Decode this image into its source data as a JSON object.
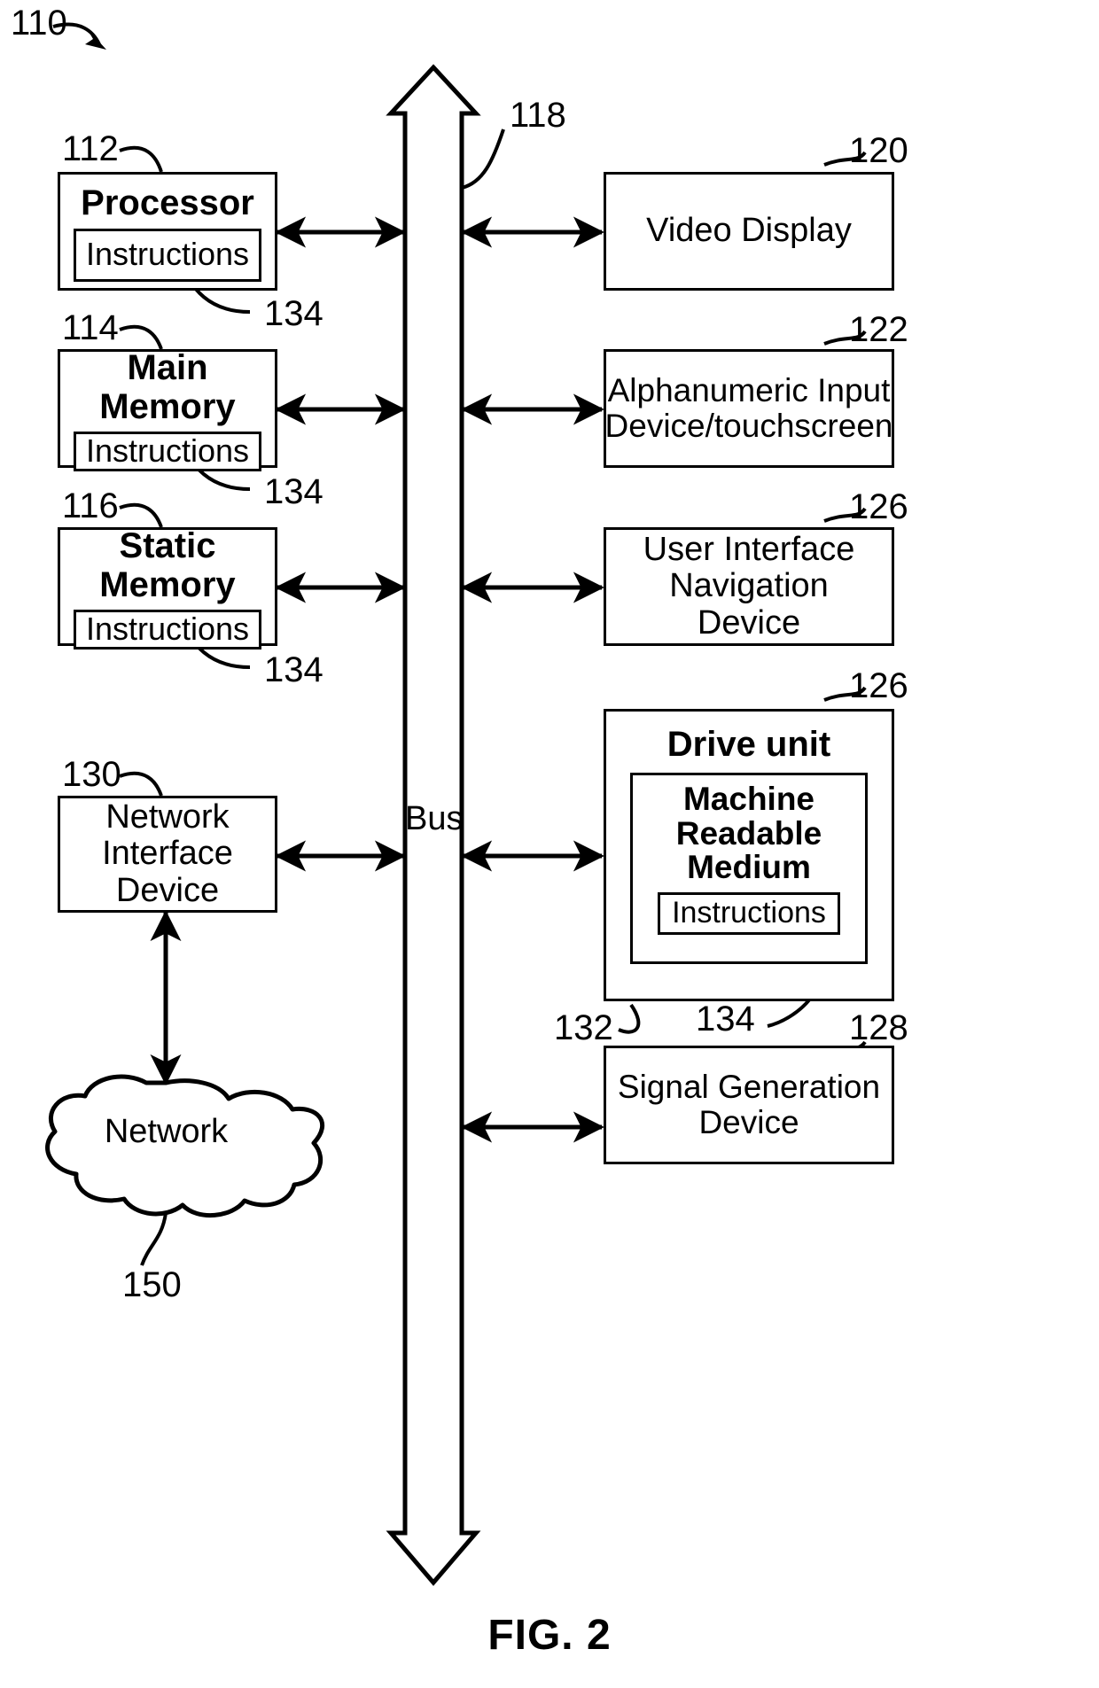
{
  "figure": {
    "caption": "FIG. 2",
    "system_ref": "110",
    "bus_label": "Bus",
    "bus_ref": "118"
  },
  "left_column": [
    {
      "ref": "112",
      "title": "Processor",
      "inner_label": "Instructions",
      "inner_ref": "134"
    },
    {
      "ref": "114",
      "title": "Main Memory",
      "inner_label": "Instructions",
      "inner_ref": "134"
    },
    {
      "ref": "116",
      "title": "Static Memory",
      "inner_label": "Instructions",
      "inner_ref": "134"
    },
    {
      "ref": "130",
      "title": "Network\nInterface\nDevice",
      "line1": "Network",
      "line2": "Interface",
      "line3": "Device"
    }
  ],
  "network_cloud": {
    "label": "Network",
    "ref": "150"
  },
  "right_column": [
    {
      "ref": "120",
      "line1": "Video Display"
    },
    {
      "ref": "122",
      "line1": "Alphanumeric Input",
      "line2": "Device/touchscreen"
    },
    {
      "ref": "126",
      "line1": "User Interface",
      "line2": "Navigation",
      "line3": "Device"
    },
    {
      "ref": "128",
      "line1": "Signal Generation",
      "line2": "Device"
    }
  ],
  "drive_unit": {
    "ref": "126",
    "title": "Drive unit",
    "medium_line1": "Machine",
    "medium_line2": "Readable",
    "medium_line3": "Medium",
    "medium_ref": "132",
    "instructions_label": "Instructions",
    "instructions_ref": "134"
  }
}
